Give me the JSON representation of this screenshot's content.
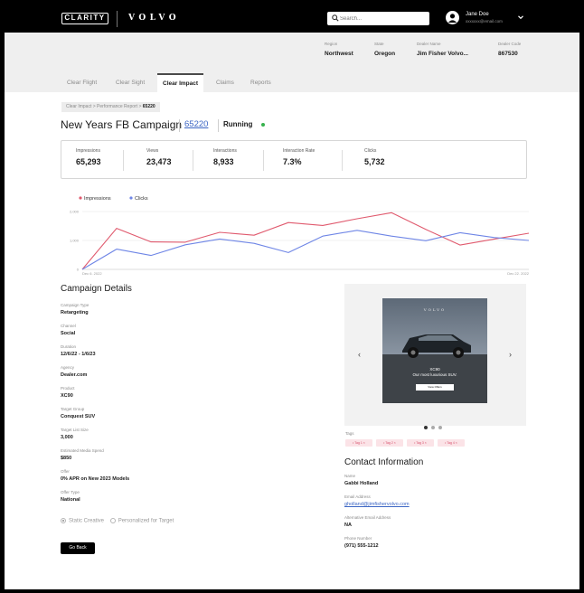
{
  "header": {
    "logo_text": "CLARITY",
    "brand_text": "VOLVO",
    "search_placeholder": "Search...",
    "user_name": "Jane Doe",
    "user_email": "xxxxxxx@email.com"
  },
  "dealer": {
    "region": {
      "label": "Region",
      "value": "Northwest"
    },
    "state": {
      "label": "State",
      "value": "Oregon"
    },
    "dealer_name": {
      "label": "Dealer Name",
      "value": "Jim Fisher Volvo..."
    },
    "dealer_code": {
      "label": "Dealer Code",
      "value": "867530"
    }
  },
  "tabs": [
    "Clear Flight",
    "Clear Sight",
    "Clear Impact",
    "Claims",
    "Reports"
  ],
  "active_tab": "Clear Impact",
  "breadcrumb": [
    "Clear Impact",
    "Performance Report",
    "65220"
  ],
  "campaign": {
    "title": "New Years FB Campaign",
    "id": "65220",
    "status": "Running",
    "status_color": "#37b24d"
  },
  "metrics": [
    {
      "label": "Impressions",
      "value": "65,293"
    },
    {
      "label": "Views",
      "value": "23,473"
    },
    {
      "label": "Interactions",
      "value": "8,933"
    },
    {
      "label": "Interaction Rate",
      "value": "7.3%"
    },
    {
      "label": "Clicks",
      "value": "5,732"
    }
  ],
  "chart_data": {
    "type": "line",
    "title": "",
    "xlabel": "",
    "ylabel": "",
    "x_start": "Dec 6, 2022",
    "x_end": "Dec 22, 2022",
    "x_tick_labels": [
      "Dec 6, 2022",
      "Dec 22, 2022"
    ],
    "y_ticks": [
      "0",
      "1,000",
      "2,000"
    ],
    "ylim": [
      0,
      2000
    ],
    "grid": true,
    "legend": "top-left",
    "series": [
      {
        "name": "Impressions",
        "color": "#e05a6e",
        "values": [
          0,
          1420,
          950,
          940,
          1280,
          1180,
          1620,
          1520,
          1750,
          1960,
          1380,
          840,
          1050,
          1250
        ]
      },
      {
        "name": "Clicks",
        "color": "#6f86e6",
        "values": [
          0,
          700,
          480,
          850,
          1050,
          900,
          580,
          1150,
          1350,
          1150,
          990,
          1270,
          1100,
          1000
        ]
      }
    ]
  },
  "details": {
    "title": "Campaign Details",
    "fields": [
      {
        "label": "Campaign Type",
        "value": "Retargeting"
      },
      {
        "label": "Channel",
        "value": "Social"
      },
      {
        "label": "Duration",
        "value": "12/6/22  -  1/6/23"
      },
      {
        "label": "Agency",
        "value": "Dealer.com"
      },
      {
        "label": "Product",
        "value": "XC90"
      },
      {
        "label": "Target Group",
        "value": "Conquest SUV"
      },
      {
        "label": "Target List Size",
        "value": "3,000"
      },
      {
        "label": "Estimated Media Spend",
        "value": "$850"
      },
      {
        "label": "Offer",
        "value": "0% APR on New 2023 Models"
      },
      {
        "label": "Offer Type",
        "value": "National"
      }
    ],
    "creative_options": [
      "Static Creative",
      "Personalized for Target"
    ],
    "go_back": "Go Back"
  },
  "ad": {
    "brand": "VOLVO",
    "model": "XC90",
    "tagline": "Our most luxurious SUV.",
    "cta": "View Offers"
  },
  "tags": {
    "label": "Tags",
    "items": [
      "• Tag 1 ×",
      "• Tag 2 ×",
      "• Tag 3 ×",
      "• Tag 4 ×"
    ]
  },
  "contact": {
    "title": "Contact Information",
    "fields": [
      {
        "label": "Name",
        "value": "Gabbi Holland"
      },
      {
        "label": "Email Address",
        "value": "gholland@jimfishervolvo.com"
      },
      {
        "label": "Alternative Email Address",
        "value": "NA"
      },
      {
        "label": "Phone Number",
        "value": "(971) 555-1212"
      }
    ]
  }
}
